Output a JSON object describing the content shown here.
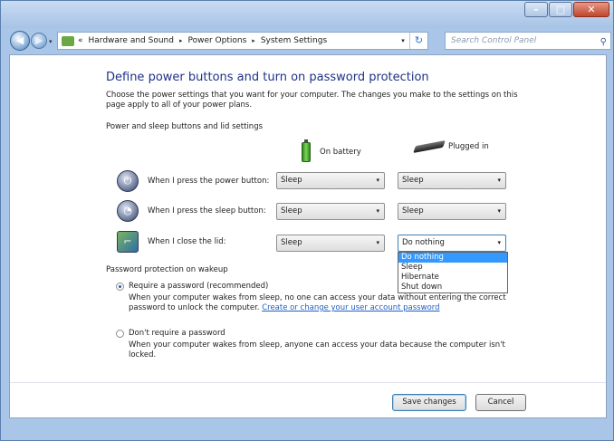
{
  "window": {
    "minimize": "–",
    "maximize": "□",
    "close": "✕"
  },
  "nav": {
    "back_glyph": "◀",
    "forward_glyph": "▶",
    "dropdown_glyph": "▾",
    "breadcrumb_prefix": "«",
    "breadcrumb": [
      "Hardware and Sound",
      "Power Options",
      "System Settings"
    ],
    "separator": "▸",
    "refresh_glyph": "↻",
    "search_placeholder": "Search Control Panel",
    "search_icon_glyph": "⚲"
  },
  "page": {
    "title": "Define power buttons and turn on password protection",
    "description": "Choose the power settings that you want for your computer. The changes you make to the settings on this page apply to all of your power plans.",
    "section_label": "Power and sleep buttons and lid settings",
    "columns": {
      "battery": "On battery",
      "plugged": "Plugged in"
    }
  },
  "rows": [
    {
      "label": "When I press the power button:",
      "icon": "power-button-icon",
      "glyph": "⏻",
      "battery": "Sleep",
      "plugged": "Sleep"
    },
    {
      "label": "When I press the sleep button:",
      "icon": "sleep-button-icon",
      "glyph": "◔",
      "battery": "Sleep",
      "plugged": "Sleep"
    },
    {
      "label": "When I close the lid:",
      "icon": "laptop-lid-icon",
      "glyph": "⌐",
      "battery": "Sleep",
      "plugged": "Do nothing"
    }
  ],
  "combo_arrow": "▾",
  "dropdown": {
    "options": [
      "Do nothing",
      "Sleep",
      "Hibernate",
      "Shut down"
    ],
    "selected": "Do nothing"
  },
  "password": {
    "section_label": "Password protection on wakeup",
    "require_title": "Require a password (recommended)",
    "require_desc": "When your computer wakes from sleep, no one can access your data without entering the correct password to unlock the computer.",
    "require_link": "Create or change your user account password",
    "norequire_title": "Don't require a password",
    "norequire_desc": "When your computer wakes from sleep, anyone can access your data because the computer isn't locked.",
    "selected": "require"
  },
  "buttons": {
    "save": "Save changes",
    "cancel": "Cancel"
  }
}
